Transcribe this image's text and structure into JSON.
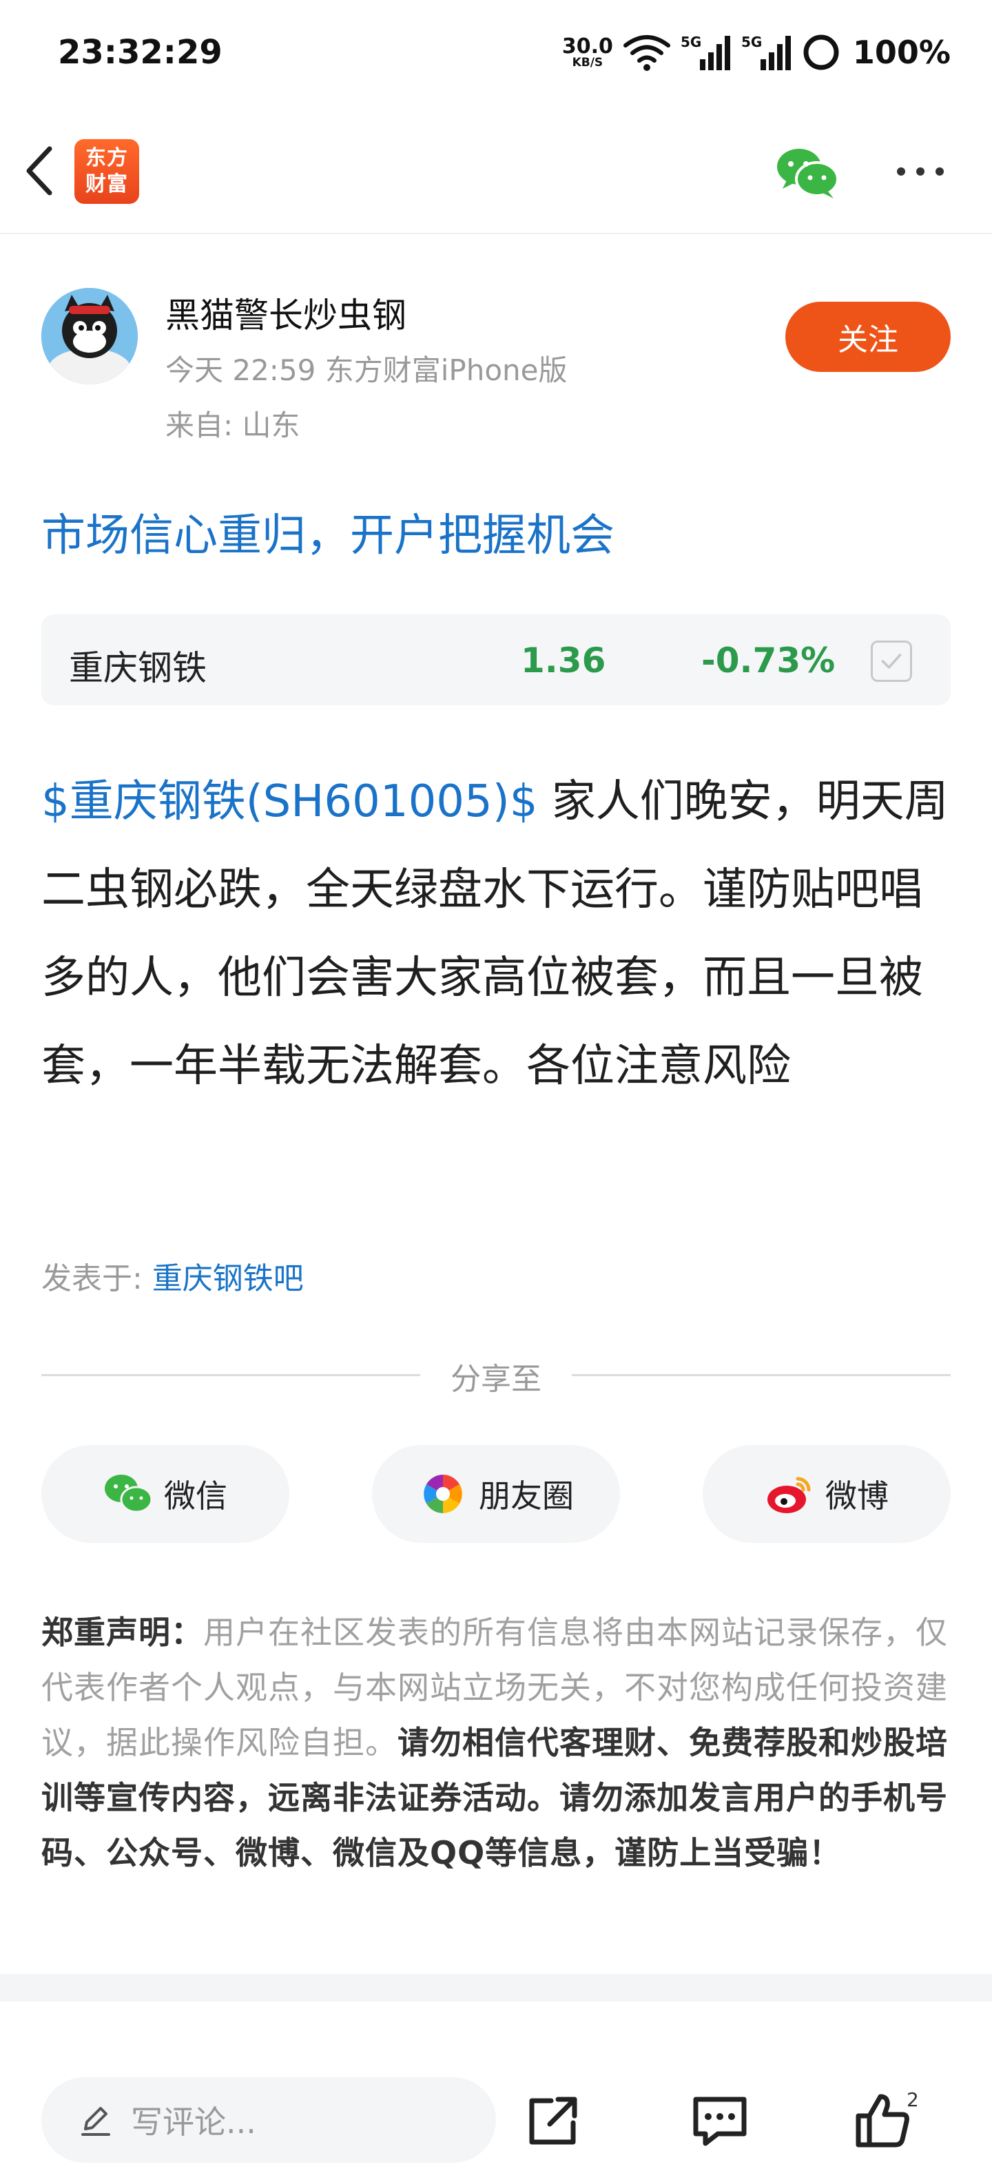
{
  "status_bar": {
    "time": "23:32:29",
    "net_speed_value": "30.0",
    "net_speed_unit": "KB/S",
    "signal_1": "5G",
    "signal_2": "5G",
    "battery": "100%"
  },
  "nav": {
    "logo_line1": "东方",
    "logo_line2": "财富",
    "icons": [
      "back-icon",
      "wechat-icon",
      "more-icon"
    ]
  },
  "author": {
    "name": "黑猫警长炒虫钢",
    "meta": "今天 22:59 东方财富iPhone版",
    "from": "来自: 山东",
    "follow_label": "关注"
  },
  "post": {
    "title": "市场信心重归，开户把握机会",
    "stock": {
      "name": "重庆钢铁",
      "price": "1.36",
      "change": "-0.73%"
    },
    "stock_tag": "$重庆钢铁(SH601005)$",
    "body": " 家人们晚安，明天周二虫钢必跌，全天绿盘水下运行。谨防贴吧唱多的人，他们会害大家高位被套，而且一旦被套，一年半载无法解套。各位注意风险",
    "posted_in_label": "发表于: ",
    "posted_in_bar": "重庆钢铁吧"
  },
  "share": {
    "label": "分享至",
    "buttons": [
      {
        "label": "微信",
        "icon": "wechat-icon"
      },
      {
        "label": "朋友圈",
        "icon": "moments-icon"
      },
      {
        "label": "微博",
        "icon": "weibo-icon"
      }
    ]
  },
  "disclaimer": {
    "lead": "郑重声明：",
    "normal": "用户在社区发表的所有信息将由本网站记录保存，仅代表作者个人观点，与本网站立场无关，不对您构成任何投资建议，据此操作风险自担。",
    "bold": "请勿相信代客理财、免费荐股和炒股培训等宣传内容，远离非法证券活动。请勿添加发言用户的手机号码、公众号、微博、微信及QQ等信息，谨防上当受骗！"
  },
  "bottom_bar": {
    "comment_placeholder": "写评论...",
    "like_count": "2",
    "icons": [
      "pen-icon",
      "share-out-icon",
      "comment-icon",
      "thumbs-up-icon"
    ]
  },
  "colors": {
    "accent_blue": "#1a73c8",
    "follow_orange": "#ee5418",
    "stock_green": "#2c9a4b"
  }
}
